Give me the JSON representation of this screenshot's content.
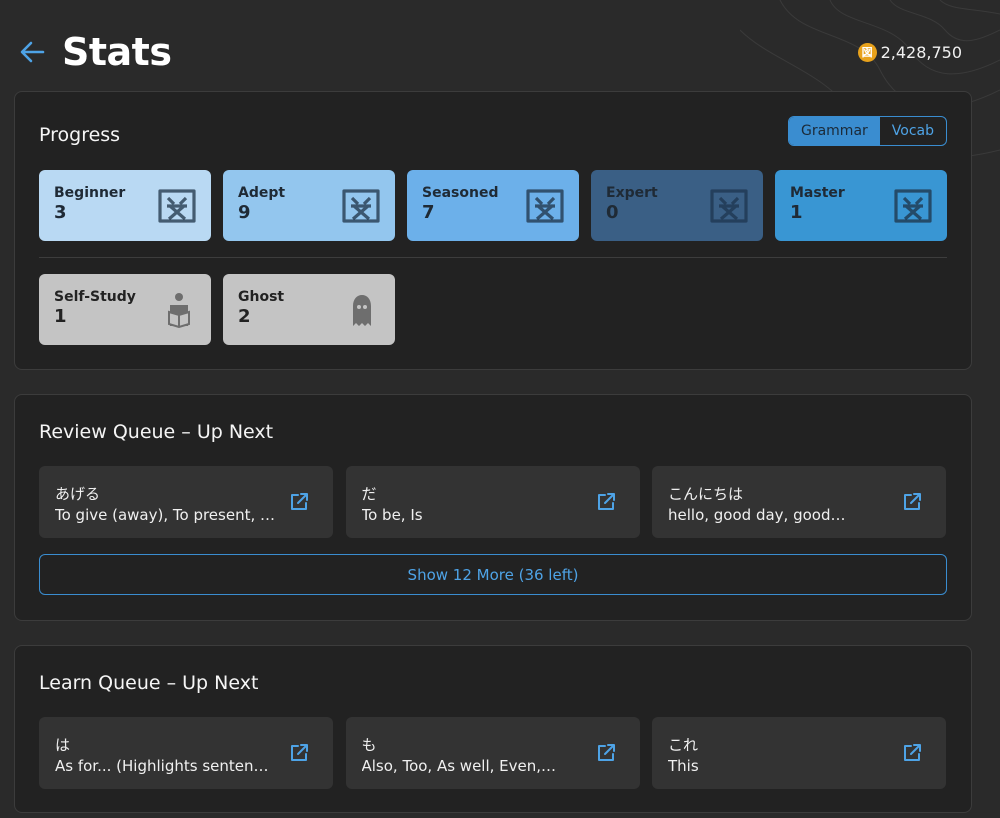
{
  "header": {
    "title": "Stats",
    "coins": "2,428,750",
    "coin_glyph": "図"
  },
  "progress": {
    "title": "Progress",
    "toggle": {
      "options": [
        "Grammar",
        "Vocab"
      ],
      "active": "Grammar"
    },
    "levels": [
      {
        "name": "Beginner",
        "count": "3",
        "bg": "#b9d9f3",
        "fg": "#1f2a35",
        "icon": "grammar-icon"
      },
      {
        "name": "Adept",
        "count": "9",
        "bg": "#93c6ee",
        "fg": "#1f2a35",
        "icon": "grammar-icon"
      },
      {
        "name": "Seasoned",
        "count": "7",
        "bg": "#6cb0ea",
        "fg": "#1f2a35",
        "icon": "grammar-icon"
      },
      {
        "name": "Expert",
        "count": "0",
        "bg": "#3a5f85",
        "fg": "#1f2a35",
        "icon": "grammar-icon"
      },
      {
        "name": "Master",
        "count": "1",
        "bg": "#3996d3",
        "fg": "#1f2a35",
        "icon": "grammar-icon"
      }
    ],
    "extras": [
      {
        "name": "Self-Study",
        "count": "1",
        "bg": "#c4c4c4",
        "icon": "reading-person-icon"
      },
      {
        "name": "Ghost",
        "count": "2",
        "bg": "#c4c4c4",
        "icon": "ghost-icon"
      }
    ]
  },
  "review": {
    "title": "Review Queue – Up Next",
    "items": [
      {
        "jp": "あげる",
        "en": "To give (away), To present, …"
      },
      {
        "jp": "だ",
        "en": "To be, Is"
      },
      {
        "jp": "こんにちは",
        "en": "hello, good day, good…"
      }
    ],
    "show_more": "Show 12 More (36 left)"
  },
  "learn": {
    "title": "Learn Queue – Up Next",
    "items": [
      {
        "jp": "は",
        "en": "As for... (Highlights sentenc…"
      },
      {
        "jp": "も",
        "en": "Also, Too, As well, Even,…"
      },
      {
        "jp": "これ",
        "en": "This"
      }
    ]
  },
  "colors": {
    "accent": "#3a8dd0",
    "panel": "#222222",
    "background": "#2a2a2a"
  }
}
